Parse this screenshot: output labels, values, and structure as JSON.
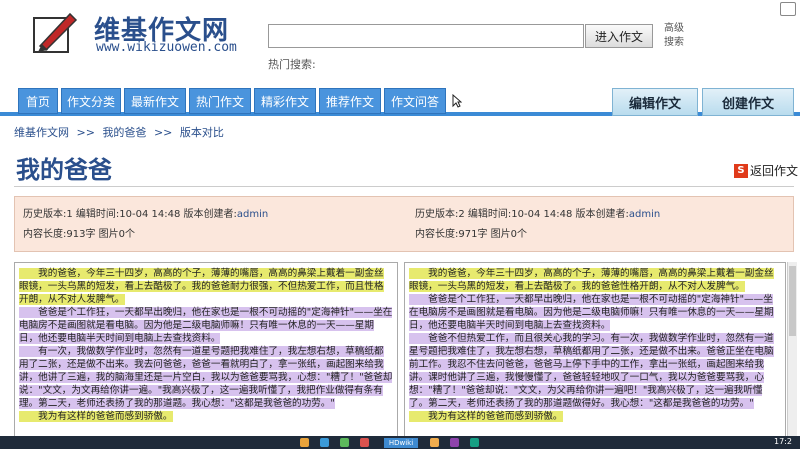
{
  "site": {
    "name": "维基作文网",
    "url": "www.wikizuowen.com"
  },
  "search": {
    "value": "",
    "placeholder": "",
    "button_label": "进入作文",
    "advanced_line1": "高级",
    "advanced_line2": "搜索",
    "hot_label": "热门搜索:"
  },
  "nav": {
    "tabs": [
      "首页",
      "作文分类",
      "最新作文",
      "热门作文",
      "精彩作文",
      "推荐作文",
      "作文问答"
    ],
    "edit_button": "编辑作文",
    "create_button": "创建作文"
  },
  "breadcrumb": [
    "维基作文网",
    ">>",
    "我的爸爸",
    ">>",
    "版本对比"
  ],
  "page": {
    "title": "我的爸爸",
    "back_label": "返回作文",
    "back_icon_letter": "S"
  },
  "versions": [
    {
      "line1_prefix": "历史版本:1  编辑时间:10-04 14:48  版本创建者:",
      "creator": "admin",
      "line2": "内容长度:913字  图片0个"
    },
    {
      "line1_prefix": "历史版本:2  编辑时间:10-04 14:48  版本创建者:",
      "creator": "admin",
      "line2": "内容长度:971字  图片0个"
    }
  ],
  "left_text": {
    "p1": "　　我的爸爸，今年三十四岁，高高的个子，薄薄的嘴唇，高高的鼻梁上戴着一副金丝眼镜，一头乌黑的短发，看上去酷极了。我的爸爸耐力很强，不但热爱工作，而且性格开朗，从不对人发脾气。",
    "p2": "　　爸爸是个工作狂，一天都早出晚归，他在家也是一根不可动摇的\"定海神针\"——坐在电脑房不是画图就是看电脑。因为他是二级电脑师嘛！只有唯一休息的一天——星期日，他还要电脑半天时间到电脑上去查找资料。",
    "p3": "　　有一次，我做数学作业时，忽然有一道星号题把我难住了，我左想右想，草稿纸都用了二张，还是做不出来。我去问爸爸，爸爸一看就明白了，拿一张纸，画起图来给我讲，他讲了三遍，我的脑海里还是一片空白，我以为爸爸要骂我，心想：\"糟了！\"爸爸却说：\"文文，为文再给你讲一遍。\"我高兴极了，这一遍我听懂了，我把作业做得有条有理。第二天，老师还表扬了我的那道题。我心想：\"这都是我爸爸的功劳。\"",
    "p4": "　　我为有这样的爸爸而感到骄傲。"
  },
  "right_text": {
    "p1": "　　我的爸爸，今年三十四岁，高高的个子，薄薄的嘴唇，高高的鼻梁上戴着一副金丝眼镜，一头乌黑的短发，看上去酷极了。我的爸爸性格开朗，从不对人发脾气。",
    "p2": "　　爸爸是个工作狂，一天都早出晚归，他在家也是一根不可动摇的\"定海神针\"——坐在电脑房不是画图就是看电脑。因为他是二级电脑师嘛！只有唯一休息的一天——星期日，他还要电脑半天时间到电脑上去查找资料。",
    "p3": "　　爸爸不但热爱工作，而且很关心我的学习。有一次，我做数学作业时，忽然有一道星号题把我难住了，我左想右想，草稿纸都用了二张，还是做不出来。爸爸正坐在电脑前工作。我忍不住去问爸爸，爸爸马上停下手中的工作，拿出一张纸，画起图来给我讲。课时他讲了三遍，我慢慢懂了，爸爸轻轻地叹了一口气，我以为爸爸要骂我，心想：\"糟了！\"爸爸却说：\"文文，为父再给你讲一遍吧！\"我高兴极了，这一遍我听懂了。第二天，老师还表扬了我的那道题做得好。我心想：\"这都是我爸爸的功劳。\"",
    "p4": "　　我为有这样的爸爸而感到骄傲。"
  },
  "taskbar": {
    "app_label": "HDwiki",
    "clock": "17:2"
  }
}
